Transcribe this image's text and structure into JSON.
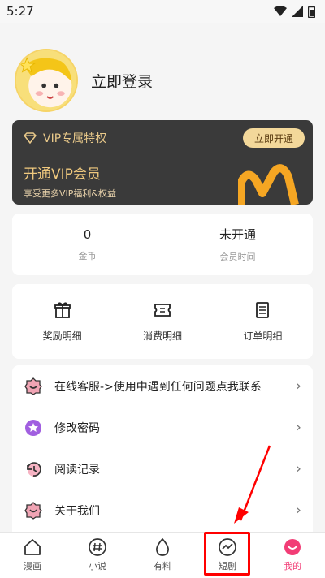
{
  "status_bar": {
    "time": "5:27"
  },
  "profile": {
    "login_text": "立即登录"
  },
  "vip": {
    "title": "VIP专属特权",
    "open_button": "立即开通",
    "headline": "开通VIP会员",
    "subtitle": "享受更多VIP福利&权益",
    "accent_color": "#f5a623"
  },
  "stats": [
    {
      "value": "0",
      "label": "金币"
    },
    {
      "value": "未开通",
      "label": "会员时间"
    }
  ],
  "records": [
    {
      "icon": "gift-icon",
      "label": "奖励明细"
    },
    {
      "icon": "ticket-icon",
      "label": "消费明细"
    },
    {
      "icon": "order-list-icon",
      "label": "订单明细"
    }
  ],
  "menu": [
    {
      "icon": "customer-service-icon",
      "label": "在线客服->使用中遇到任何问题点我联系"
    },
    {
      "icon": "password-icon",
      "label": "修改密码"
    },
    {
      "icon": "history-icon",
      "label": "阅读记录"
    },
    {
      "icon": "about-icon",
      "label": "关于我们"
    }
  ],
  "bottom_nav": [
    {
      "icon": "home-icon",
      "label": "漫画"
    },
    {
      "icon": "hash-icon",
      "label": "小说"
    },
    {
      "icon": "egg-icon",
      "label": "有料"
    },
    {
      "icon": "trend-icon",
      "label": "短剧"
    },
    {
      "icon": "smile-icon",
      "label": "我的"
    }
  ],
  "colors": {
    "brand_pink": "#f23d76",
    "vip_gold": "#e9c98a",
    "highlight": "#ff0000"
  }
}
